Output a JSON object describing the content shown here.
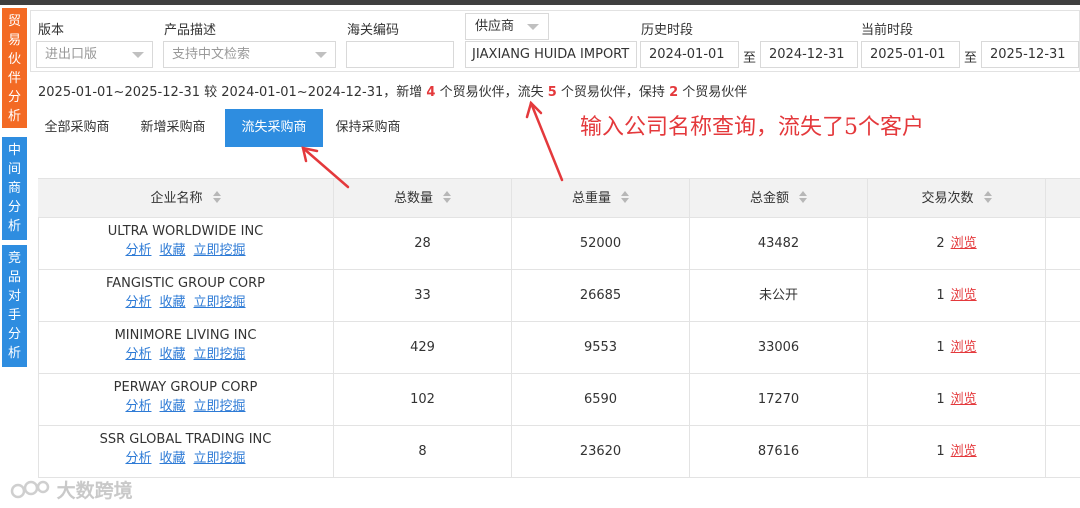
{
  "sidebar": {
    "tabs": [
      {
        "label": "贸易伙伴分析",
        "chars": [
          "贸",
          "易",
          "伙",
          "伴",
          "分",
          "析"
        ]
      },
      {
        "label": "中间商分析",
        "chars": [
          "中",
          "间",
          "商",
          "分",
          "析"
        ]
      },
      {
        "label": "竞品对手分析",
        "chars": [
          "竞",
          "品",
          "对",
          "手",
          "分",
          "析"
        ]
      }
    ]
  },
  "filters": {
    "version_label": "版本",
    "version_value": "进出口版",
    "product_label": "产品描述",
    "product_placeholder": "支持中文检索",
    "hs_label": "海关编码",
    "hs_value": "",
    "supplier_select": "供应商",
    "supplier_value": "JIAXIANG HUIDA IMPORT",
    "history_label": "历史时段",
    "history_start": "2024-01-01",
    "history_sep": "至",
    "history_end": "2024-12-31",
    "current_label": "当前时段",
    "current_start": "2025-01-01",
    "current_sep": "至",
    "current_end": "2025-12-31"
  },
  "summary": {
    "prefix": "2025-01-01~2025-12-31 较 2024-01-01~2024-12-31，新增",
    "new_count": "4",
    "mid1": "个贸易伙伴，流失",
    "lost_count": "5",
    "mid2": "个贸易伙伴，保持",
    "keep_count": "2",
    "suffix": "个贸易伙伴"
  },
  "tabs": [
    {
      "label": "全部采购商"
    },
    {
      "label": "新增采购商"
    },
    {
      "label": "流失采购商",
      "active": true
    },
    {
      "label": "保持采购商"
    }
  ],
  "annotation": "输入公司名称查询，流失了5个客户",
  "table": {
    "headers": [
      "企业名称",
      "总数量",
      "总重量",
      "总金额",
      "交易次数"
    ],
    "link_labels": {
      "analyze": "分析",
      "favorite": "收藏",
      "mine": "立即挖掘",
      "browse": "浏览"
    },
    "rows": [
      {
        "name": "ULTRA WORLDWIDE INC",
        "qty": "28",
        "weight": "52000",
        "amount": "43482",
        "trades": "2"
      },
      {
        "name": "FANGISTIC GROUP CORP",
        "qty": "33",
        "weight": "26685",
        "amount": "未公开",
        "trades": "1"
      },
      {
        "name": "MINIMORE LIVING INC",
        "qty": "429",
        "weight": "9553",
        "amount": "33006",
        "trades": "1"
      },
      {
        "name": "PERWAY GROUP CORP",
        "qty": "102",
        "weight": "6590",
        "amount": "17270",
        "trades": "1"
      },
      {
        "name": "SSR GLOBAL TRADING INC",
        "qty": "8",
        "weight": "23620",
        "amount": "87616",
        "trades": "1"
      }
    ]
  },
  "watermark": "大数跨境",
  "colors": {
    "accent": "#2e8de0",
    "sidebar_active": "#f36a24",
    "highlight": "#e4393c",
    "link": "#2e7bd6"
  }
}
